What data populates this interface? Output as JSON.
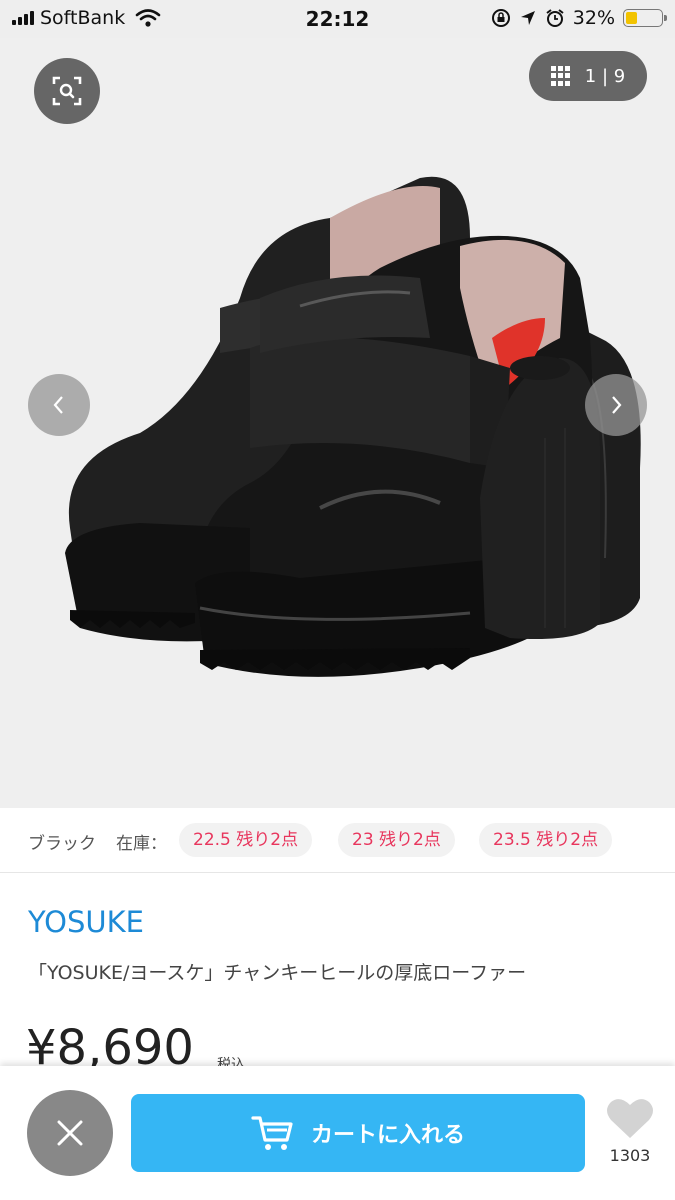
{
  "status_bar": {
    "carrier": "SoftBank",
    "time": "22:12",
    "battery": "32%",
    "battery_color": "#f2c300"
  },
  "gallery": {
    "counter": "1 | 9",
    "icons": [
      "search-lens-icon",
      "grid-icon",
      "chevron-left-icon",
      "chevron-right-icon"
    ]
  },
  "stock": {
    "color": "ブラック",
    "label": "在庫：",
    "chips": [
      "22.5 残り2点",
      "23 残り2点",
      "23.5 残り2点"
    ]
  },
  "product": {
    "brand": "YOSUKE",
    "title": "「YOSUKE/ヨースケ」チャンキーヒールの厚底ローファー",
    "price": "¥8,690",
    "tax": "税込"
  },
  "footer": {
    "cart_label": "カートに入れる",
    "favorite_count": "1303",
    "accent_color": "#35b6f4"
  }
}
